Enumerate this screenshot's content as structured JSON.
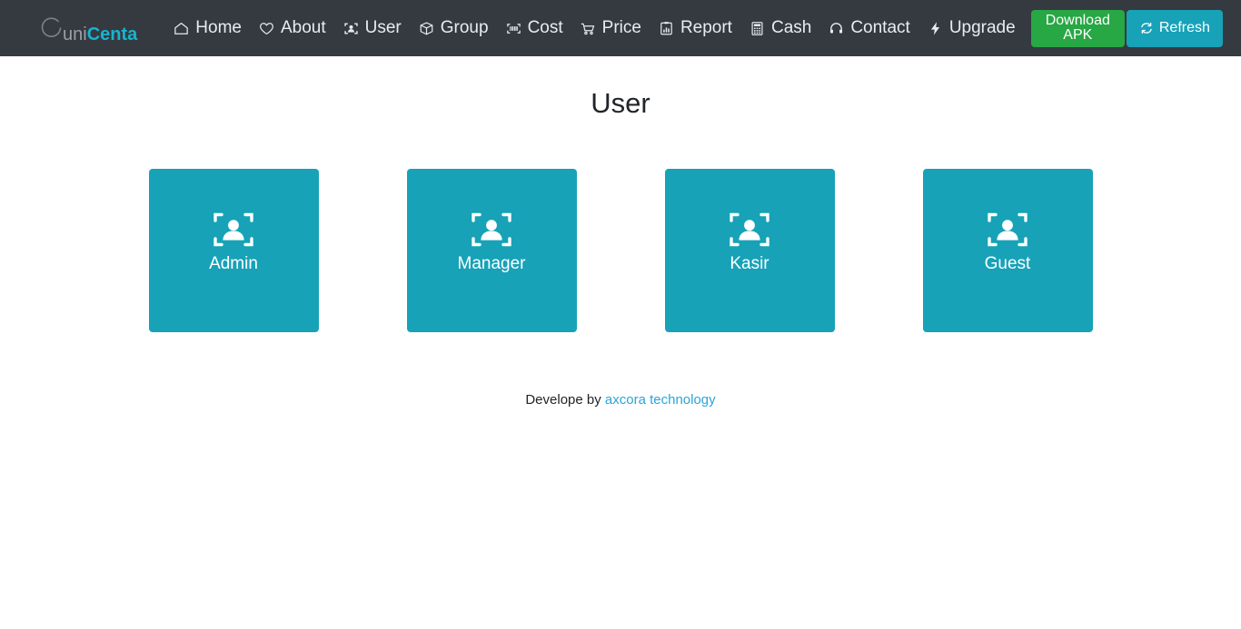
{
  "brand": {
    "icon": "circle-arc-logo",
    "text_primary": "uni",
    "text_accent": "Centa"
  },
  "navbar": {
    "background_color": "#343a40",
    "links": [
      {
        "label": "Home",
        "icon": "home-icon"
      },
      {
        "label": "About",
        "icon": "heart-icon"
      },
      {
        "label": "User",
        "icon": "user-frame-icon"
      },
      {
        "label": "Group",
        "icon": "box-icon"
      },
      {
        "label": "Cost",
        "icon": "barcode-icon"
      },
      {
        "label": "Price",
        "icon": "shopping-cart-icon"
      },
      {
        "label": "Report",
        "icon": "report-chart-icon"
      },
      {
        "label": "Cash",
        "icon": "calculator-icon"
      },
      {
        "label": "Contact",
        "icon": "headset-icon"
      },
      {
        "label": "Upgrade",
        "icon": "lightning-bolt-icon"
      }
    ],
    "buttons": {
      "download_apk": {
        "label": "Download APK",
        "color": "#28a745"
      },
      "refresh": {
        "label": "Refresh",
        "icon": "refresh-icon",
        "color": "#17a2b8"
      }
    }
  },
  "main": {
    "title": "User",
    "card_color": "#17a2b8",
    "cards": [
      {
        "label": "Admin",
        "icon": "user-frame-icon"
      },
      {
        "label": "Manager",
        "icon": "user-frame-icon"
      },
      {
        "label": "Kasir",
        "icon": "user-frame-icon"
      },
      {
        "label": "Guest",
        "icon": "user-frame-icon"
      }
    ]
  },
  "footer": {
    "text": "Develope by",
    "link_label": "axcora technology",
    "link_color": "#2ba6d6"
  }
}
